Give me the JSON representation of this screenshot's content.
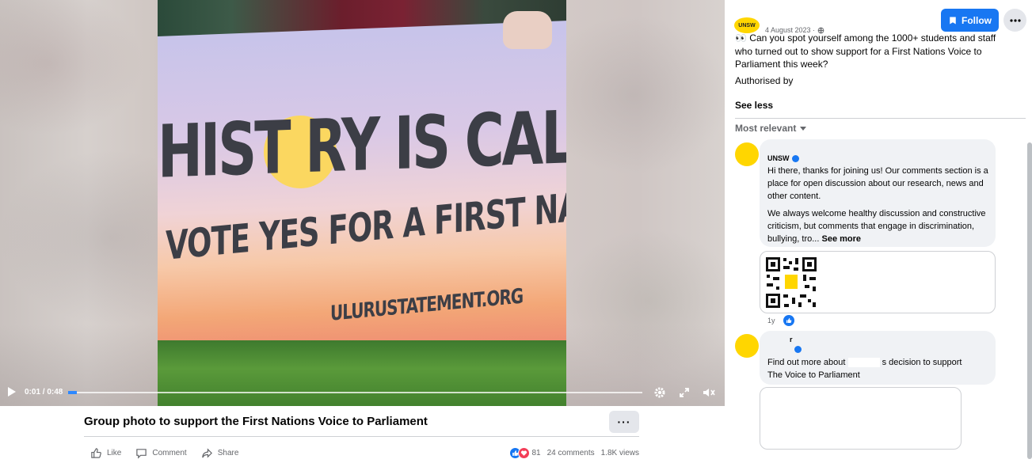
{
  "video": {
    "sign_line1": "HIST  RY IS CALLING",
    "sign_line2": "VOTE YES FOR A FIRST NATIONS VOICE",
    "sign_line3": "ULURUSTATEMENT.ORG",
    "time": "0:01 / 0:48",
    "progress": 0.015
  },
  "title": "Group photo to support the First Nations Voice to Parliament",
  "more_label": "···",
  "actions": {
    "like": "Like",
    "comment": "Comment",
    "share": "Share"
  },
  "stats": {
    "reactions": "81",
    "comments": "24 comments",
    "views": "1.8K views"
  },
  "post": {
    "page_avatar_text": "UNSW",
    "date": "4 August 2023 ·",
    "follow_label": "Follow",
    "text": "👀 Can you spot yourself among the 1000+ students and staff who turned out to show support for a First Nations Voice to Parliament this week?",
    "authorised": "Authorised by",
    "see_less": "See less",
    "sort_label": "Most relevant"
  },
  "comments": [
    {
      "author": "UNSW",
      "text1": "Hi there, thanks for joining us! Our comments section is a place for open discussion about our research, news and other content.",
      "text2": "We always welcome healthy discussion and constructive criticism, but comments that engage in discrimination, bullying, tro...",
      "see_more": "See more",
      "age": "1y"
    },
    {
      "author": "r",
      "text_a": "Find out more about",
      "text_b": "s decision to support",
      "text_c": "The Voice to Parliament"
    }
  ],
  "colors": {
    "accent": "#1877f2",
    "love": "#f33e58",
    "brand_yellow": "#ffd600"
  }
}
